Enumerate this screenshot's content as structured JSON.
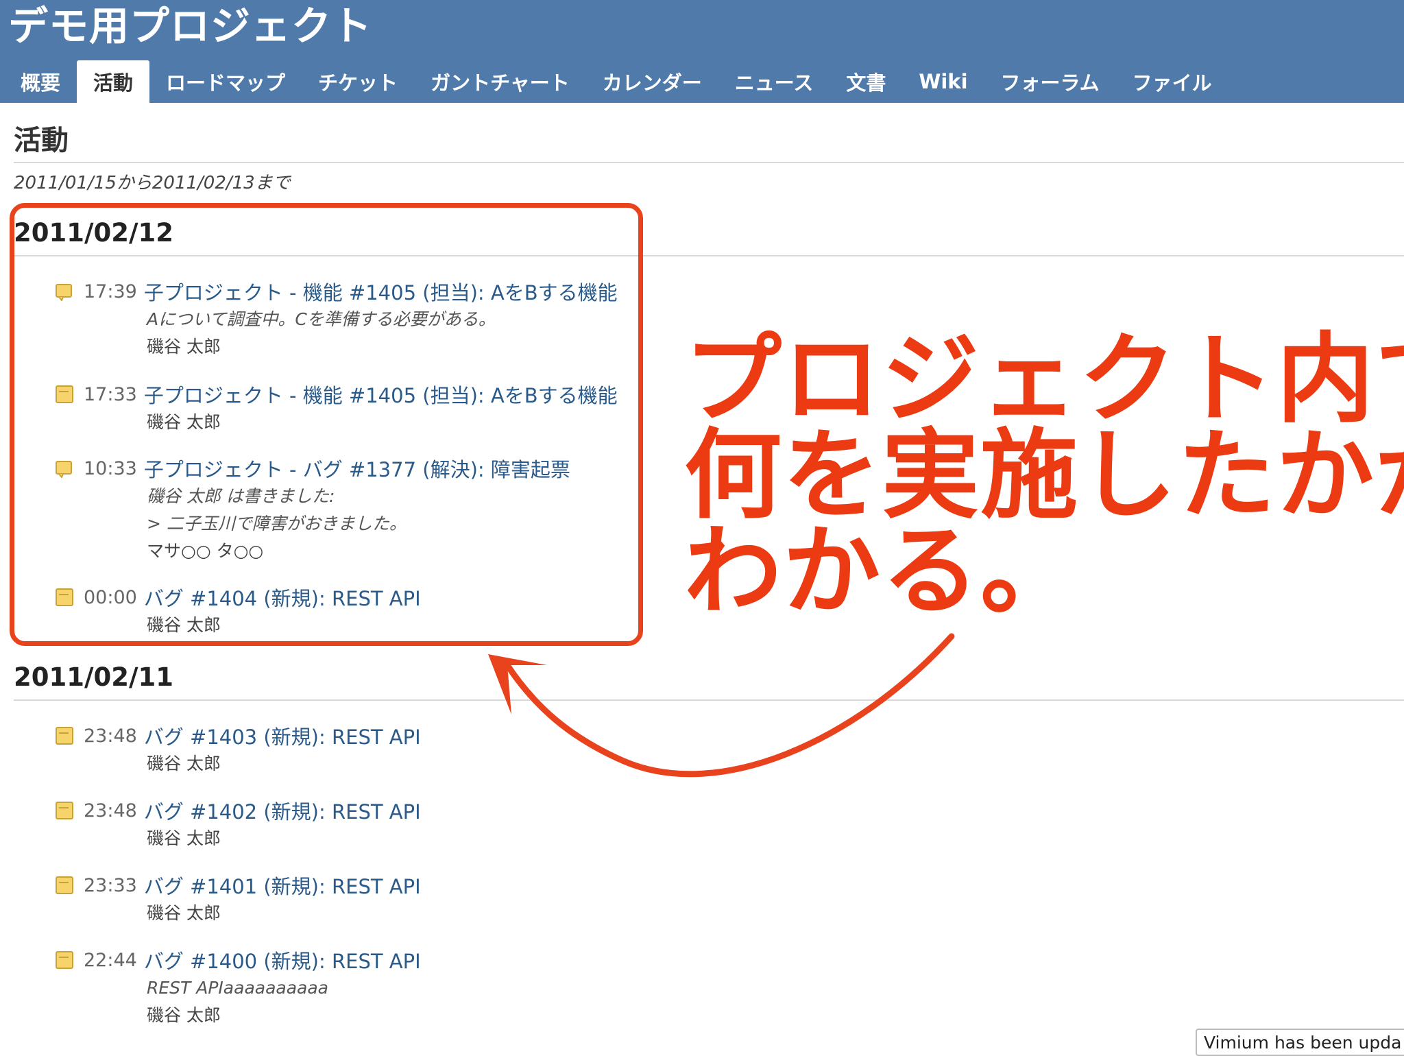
{
  "header": {
    "project_title": "デモ用プロジェクト",
    "tabs": [
      {
        "label": "概要"
      },
      {
        "label": "活動",
        "selected": true
      },
      {
        "label": "ロードマップ"
      },
      {
        "label": "チケット"
      },
      {
        "label": "ガントチャート"
      },
      {
        "label": "カレンダー"
      },
      {
        "label": "ニュース"
      },
      {
        "label": "文書"
      },
      {
        "label": "Wiki"
      },
      {
        "label": "フォーラム"
      },
      {
        "label": "ファイル"
      }
    ]
  },
  "activity": {
    "title": "活動",
    "date_range": "2011/01/15から2011/02/13まで",
    "days": [
      {
        "date": "2011/02/12",
        "events": [
          {
            "icon": "issue-note-icon",
            "time": "17:39",
            "link": "子プロジェクト - 機能 #1405 (担当): AをBする機能",
            "description": "Aについて調査中。Cを準備する必要がある。",
            "author": "磯谷 太郎"
          },
          {
            "icon": "issue-icon",
            "time": "17:33",
            "link": "子プロジェクト - 機能 #1405 (担当): AをBする機能",
            "author": "磯谷 太郎"
          },
          {
            "icon": "issue-note-icon",
            "time": "10:33",
            "link": "子プロジェクト - バグ #1377 (解決): 障害起票",
            "description": "磯谷 太郎 は書きました:",
            "description2": "> 二子玉川で障害がおきました。",
            "author": "マサ○○ タ○○"
          },
          {
            "icon": "issue-icon",
            "time": "00:00",
            "link": "バグ #1404 (新規): REST API",
            "author": "磯谷 太郎"
          }
        ]
      },
      {
        "date": "2011/02/11",
        "events": [
          {
            "icon": "issue-icon",
            "time": "23:48",
            "link": "バグ #1403 (新規): REST API",
            "author": "磯谷 太郎"
          },
          {
            "icon": "issue-icon",
            "time": "23:48",
            "link": "バグ #1402 (新規): REST API",
            "author": "磯谷 太郎"
          },
          {
            "icon": "issue-icon",
            "time": "23:33",
            "link": "バグ #1401 (新規): REST API",
            "author": "磯谷 太郎"
          },
          {
            "icon": "issue-icon",
            "time": "22:44",
            "link": "バグ #1400 (新規): REST API",
            "description": "REST APIaaaaaaaaaa",
            "author": "磯谷 太郎"
          }
        ]
      }
    ]
  },
  "annotation": {
    "lines": [
      "プロジェクト内で",
      "何を実施したかが",
      "わかる。"
    ],
    "color": "#ec3b12"
  },
  "toast": {
    "text": "Vimium has been upda"
  },
  "colors": {
    "header_bg": "#507aaa",
    "link": "#2a5a8a",
    "annotation": "#e8431d"
  }
}
